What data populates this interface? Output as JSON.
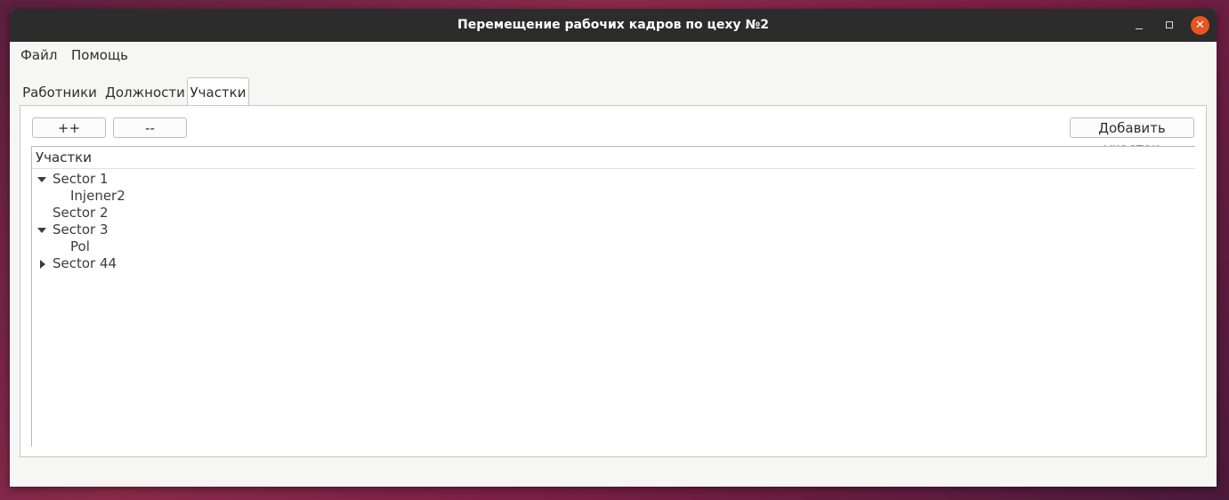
{
  "window": {
    "title": "Перемещение рабочих кадров по цеху №2",
    "close_glyph": "✕"
  },
  "menu": {
    "file": "Файл",
    "help": "Помощь"
  },
  "tabs": [
    {
      "label": "Работники",
      "active": false
    },
    {
      "label": "Должности",
      "active": false
    },
    {
      "label": "Участки",
      "active": true
    }
  ],
  "toolbar": {
    "expand_all": "++",
    "collapse_all": "--",
    "add_sector": "Добавить участок"
  },
  "tree": {
    "header": "Участки",
    "items": [
      {
        "label": "Sector 1",
        "level": 0,
        "state": "expanded"
      },
      {
        "label": "Injener2",
        "level": 1,
        "state": "leaf"
      },
      {
        "label": "Sector 2",
        "level": 0,
        "state": "leaf"
      },
      {
        "label": "Sector 3",
        "level": 0,
        "state": "expanded"
      },
      {
        "label": "Pol",
        "level": 1,
        "state": "leaf"
      },
      {
        "label": "Sector 44",
        "level": 0,
        "state": "collapsed"
      }
    ]
  },
  "colors": {
    "accent": "#e95420",
    "titlebar": "#2c2c2c"
  }
}
